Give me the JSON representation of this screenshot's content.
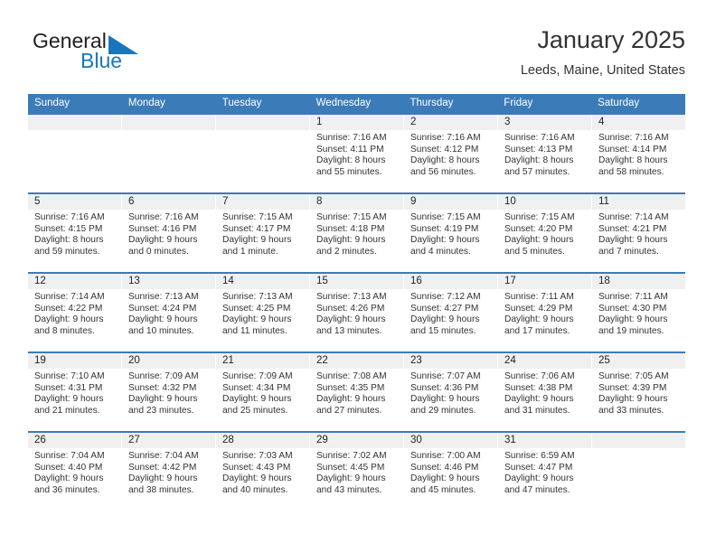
{
  "brand": {
    "name_part1": "General",
    "name_part2": "Blue",
    "accent_color": "#1b75bb"
  },
  "header": {
    "month_title": "January 2025",
    "location": "Leeds, Maine, United States"
  },
  "calendar": {
    "header_color": "#3b7cb8",
    "weekdays": [
      "Sunday",
      "Monday",
      "Tuesday",
      "Wednesday",
      "Thursday",
      "Friday",
      "Saturday"
    ],
    "weeks": [
      [
        {
          "date": "",
          "empty": true,
          "sunrise": "",
          "sunset": "",
          "daylight_line1": "",
          "daylight_line2": ""
        },
        {
          "date": "",
          "empty": true,
          "sunrise": "",
          "sunset": "",
          "daylight_line1": "",
          "daylight_line2": ""
        },
        {
          "date": "",
          "empty": true,
          "sunrise": "",
          "sunset": "",
          "daylight_line1": "",
          "daylight_line2": ""
        },
        {
          "date": "1",
          "empty": false,
          "sunrise": "Sunrise: 7:16 AM",
          "sunset": "Sunset: 4:11 PM",
          "daylight_line1": "Daylight: 8 hours",
          "daylight_line2": "and 55 minutes."
        },
        {
          "date": "2",
          "empty": false,
          "sunrise": "Sunrise: 7:16 AM",
          "sunset": "Sunset: 4:12 PM",
          "daylight_line1": "Daylight: 8 hours",
          "daylight_line2": "and 56 minutes."
        },
        {
          "date": "3",
          "empty": false,
          "sunrise": "Sunrise: 7:16 AM",
          "sunset": "Sunset: 4:13 PM",
          "daylight_line1": "Daylight: 8 hours",
          "daylight_line2": "and 57 minutes."
        },
        {
          "date": "4",
          "empty": false,
          "sunrise": "Sunrise: 7:16 AM",
          "sunset": "Sunset: 4:14 PM",
          "daylight_line1": "Daylight: 8 hours",
          "daylight_line2": "and 58 minutes."
        }
      ],
      [
        {
          "date": "5",
          "empty": false,
          "sunrise": "Sunrise: 7:16 AM",
          "sunset": "Sunset: 4:15 PM",
          "daylight_line1": "Daylight: 8 hours",
          "daylight_line2": "and 59 minutes."
        },
        {
          "date": "6",
          "empty": false,
          "sunrise": "Sunrise: 7:16 AM",
          "sunset": "Sunset: 4:16 PM",
          "daylight_line1": "Daylight: 9 hours",
          "daylight_line2": "and 0 minutes."
        },
        {
          "date": "7",
          "empty": false,
          "sunrise": "Sunrise: 7:15 AM",
          "sunset": "Sunset: 4:17 PM",
          "daylight_line1": "Daylight: 9 hours",
          "daylight_line2": "and 1 minute."
        },
        {
          "date": "8",
          "empty": false,
          "sunrise": "Sunrise: 7:15 AM",
          "sunset": "Sunset: 4:18 PM",
          "daylight_line1": "Daylight: 9 hours",
          "daylight_line2": "and 2 minutes."
        },
        {
          "date": "9",
          "empty": false,
          "sunrise": "Sunrise: 7:15 AM",
          "sunset": "Sunset: 4:19 PM",
          "daylight_line1": "Daylight: 9 hours",
          "daylight_line2": "and 4 minutes."
        },
        {
          "date": "10",
          "empty": false,
          "sunrise": "Sunrise: 7:15 AM",
          "sunset": "Sunset: 4:20 PM",
          "daylight_line1": "Daylight: 9 hours",
          "daylight_line2": "and 5 minutes."
        },
        {
          "date": "11",
          "empty": false,
          "sunrise": "Sunrise: 7:14 AM",
          "sunset": "Sunset: 4:21 PM",
          "daylight_line1": "Daylight: 9 hours",
          "daylight_line2": "and 7 minutes."
        }
      ],
      [
        {
          "date": "12",
          "empty": false,
          "sunrise": "Sunrise: 7:14 AM",
          "sunset": "Sunset: 4:22 PM",
          "daylight_line1": "Daylight: 9 hours",
          "daylight_line2": "and 8 minutes."
        },
        {
          "date": "13",
          "empty": false,
          "sunrise": "Sunrise: 7:13 AM",
          "sunset": "Sunset: 4:24 PM",
          "daylight_line1": "Daylight: 9 hours",
          "daylight_line2": "and 10 minutes."
        },
        {
          "date": "14",
          "empty": false,
          "sunrise": "Sunrise: 7:13 AM",
          "sunset": "Sunset: 4:25 PM",
          "daylight_line1": "Daylight: 9 hours",
          "daylight_line2": "and 11 minutes."
        },
        {
          "date": "15",
          "empty": false,
          "sunrise": "Sunrise: 7:13 AM",
          "sunset": "Sunset: 4:26 PM",
          "daylight_line1": "Daylight: 9 hours",
          "daylight_line2": "and 13 minutes."
        },
        {
          "date": "16",
          "empty": false,
          "sunrise": "Sunrise: 7:12 AM",
          "sunset": "Sunset: 4:27 PM",
          "daylight_line1": "Daylight: 9 hours",
          "daylight_line2": "and 15 minutes."
        },
        {
          "date": "17",
          "empty": false,
          "sunrise": "Sunrise: 7:11 AM",
          "sunset": "Sunset: 4:29 PM",
          "daylight_line1": "Daylight: 9 hours",
          "daylight_line2": "and 17 minutes."
        },
        {
          "date": "18",
          "empty": false,
          "sunrise": "Sunrise: 7:11 AM",
          "sunset": "Sunset: 4:30 PM",
          "daylight_line1": "Daylight: 9 hours",
          "daylight_line2": "and 19 minutes."
        }
      ],
      [
        {
          "date": "19",
          "empty": false,
          "sunrise": "Sunrise: 7:10 AM",
          "sunset": "Sunset: 4:31 PM",
          "daylight_line1": "Daylight: 9 hours",
          "daylight_line2": "and 21 minutes."
        },
        {
          "date": "20",
          "empty": false,
          "sunrise": "Sunrise: 7:09 AM",
          "sunset": "Sunset: 4:32 PM",
          "daylight_line1": "Daylight: 9 hours",
          "daylight_line2": "and 23 minutes."
        },
        {
          "date": "21",
          "empty": false,
          "sunrise": "Sunrise: 7:09 AM",
          "sunset": "Sunset: 4:34 PM",
          "daylight_line1": "Daylight: 9 hours",
          "daylight_line2": "and 25 minutes."
        },
        {
          "date": "22",
          "empty": false,
          "sunrise": "Sunrise: 7:08 AM",
          "sunset": "Sunset: 4:35 PM",
          "daylight_line1": "Daylight: 9 hours",
          "daylight_line2": "and 27 minutes."
        },
        {
          "date": "23",
          "empty": false,
          "sunrise": "Sunrise: 7:07 AM",
          "sunset": "Sunset: 4:36 PM",
          "daylight_line1": "Daylight: 9 hours",
          "daylight_line2": "and 29 minutes."
        },
        {
          "date": "24",
          "empty": false,
          "sunrise": "Sunrise: 7:06 AM",
          "sunset": "Sunset: 4:38 PM",
          "daylight_line1": "Daylight: 9 hours",
          "daylight_line2": "and 31 minutes."
        },
        {
          "date": "25",
          "empty": false,
          "sunrise": "Sunrise: 7:05 AM",
          "sunset": "Sunset: 4:39 PM",
          "daylight_line1": "Daylight: 9 hours",
          "daylight_line2": "and 33 minutes."
        }
      ],
      [
        {
          "date": "26",
          "empty": false,
          "sunrise": "Sunrise: 7:04 AM",
          "sunset": "Sunset: 4:40 PM",
          "daylight_line1": "Daylight: 9 hours",
          "daylight_line2": "and 36 minutes."
        },
        {
          "date": "27",
          "empty": false,
          "sunrise": "Sunrise: 7:04 AM",
          "sunset": "Sunset: 4:42 PM",
          "daylight_line1": "Daylight: 9 hours",
          "daylight_line2": "and 38 minutes."
        },
        {
          "date": "28",
          "empty": false,
          "sunrise": "Sunrise: 7:03 AM",
          "sunset": "Sunset: 4:43 PM",
          "daylight_line1": "Daylight: 9 hours",
          "daylight_line2": "and 40 minutes."
        },
        {
          "date": "29",
          "empty": false,
          "sunrise": "Sunrise: 7:02 AM",
          "sunset": "Sunset: 4:45 PM",
          "daylight_line1": "Daylight: 9 hours",
          "daylight_line2": "and 43 minutes."
        },
        {
          "date": "30",
          "empty": false,
          "sunrise": "Sunrise: 7:00 AM",
          "sunset": "Sunset: 4:46 PM",
          "daylight_line1": "Daylight: 9 hours",
          "daylight_line2": "and 45 minutes."
        },
        {
          "date": "31",
          "empty": false,
          "sunrise": "Sunrise: 6:59 AM",
          "sunset": "Sunset: 4:47 PM",
          "daylight_line1": "Daylight: 9 hours",
          "daylight_line2": "and 47 minutes."
        },
        {
          "date": "",
          "empty": true,
          "sunrise": "",
          "sunset": "",
          "daylight_line1": "",
          "daylight_line2": ""
        }
      ]
    ]
  }
}
